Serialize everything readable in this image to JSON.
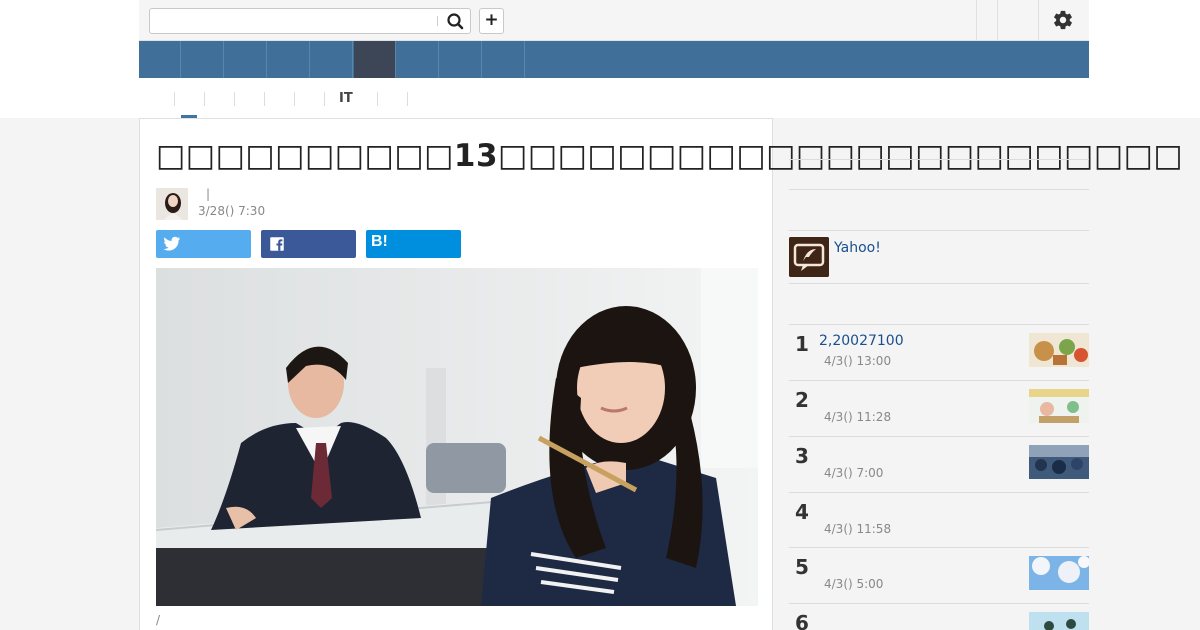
{
  "header": {
    "search_placeholder": "",
    "search_icon": "search-icon",
    "add_icon": "plus-icon",
    "add_label": "+",
    "settings_icon": "gear-icon"
  },
  "subnav": {
    "it_label": "IT"
  },
  "article": {
    "title": "□□□□□□□□□□13□□□□□□□□□□□□□□□□□□□□□□□",
    "author_separator": "|",
    "date": "3/28() 7:30",
    "share": {
      "twitter_icon": "twitter-icon",
      "facebook_icon": "facebook-icon",
      "hatena_label": "B!"
    },
    "photo_caption": "/"
  },
  "sidebar": {
    "author_name": "Yahoo!",
    "ranking": [
      {
        "rank": "1",
        "title": "2,20027100",
        "date": "4/3() 13:00"
      },
      {
        "rank": "2",
        "title": "",
        "date": "4/3() 11:28"
      },
      {
        "rank": "3",
        "title": "",
        "date": "4/3() 7:00"
      },
      {
        "rank": "4",
        "title": "",
        "date": "4/3() 11:58"
      },
      {
        "rank": "5",
        "title": "",
        "date": "4/3() 5:00"
      },
      {
        "rank": "6",
        "title": "",
        "date": ""
      }
    ]
  },
  "colors": {
    "nav": "#40709a",
    "nav_active": "#3c4657",
    "link": "#1a4f8f",
    "twitter": "#55acee",
    "facebook": "#3b5998",
    "hatena": "#008fde"
  }
}
